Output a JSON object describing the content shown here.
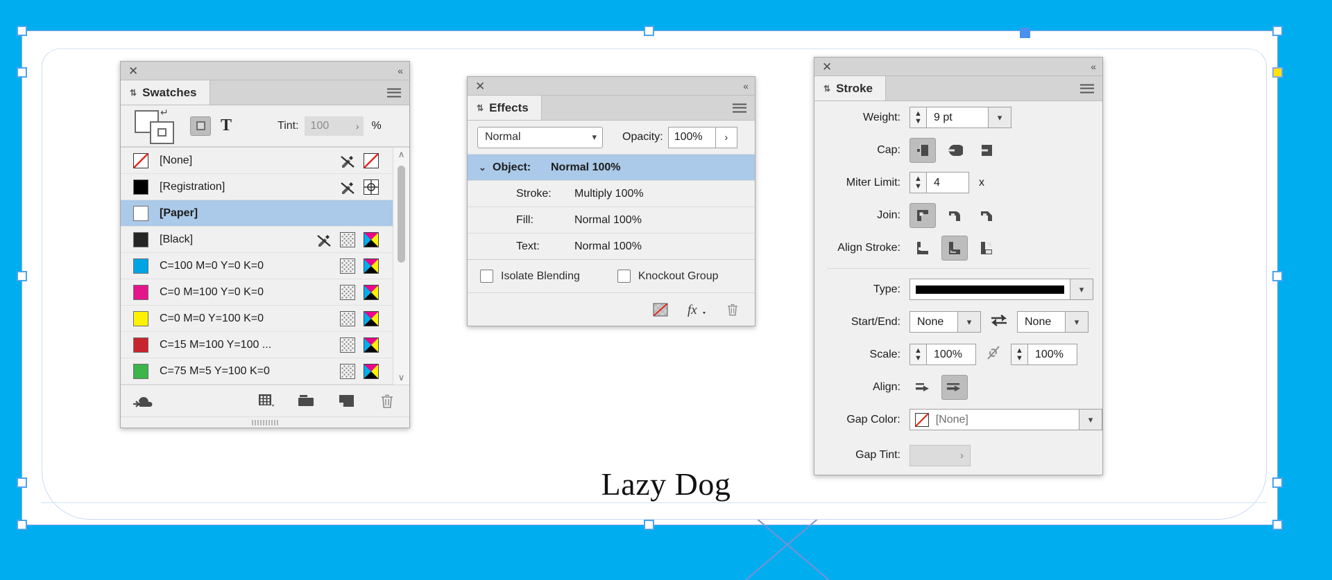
{
  "app": {
    "canvas_text": "Lazy Dog",
    "canvas_bg": "#00aeef",
    "page_bg": "#ffffff",
    "selection_color": "#4da3f0",
    "handle_yellow": "#ffe400",
    "handle_blue": "#4a90f0"
  },
  "swatches": {
    "close_label": "✕",
    "collapse_label": "«",
    "tab_label": "Swatches",
    "tab_grip": "⇅",
    "menu_name": "panel-menu-icon",
    "format_fill_icon": "fill-format-icon",
    "format_text_label": "T",
    "tint_label": "Tint:",
    "tint_value": "100",
    "tint_chevron": "›",
    "tint_unit": "%",
    "rows": [
      {
        "name": "[None]",
        "chip": "none",
        "swatch_icon": true,
        "tint_icon": false,
        "cmyk_icon": false,
        "selected": false
      },
      {
        "name": "[Registration]",
        "chip": "#000000",
        "swatch_icon": true,
        "tint_icon": false,
        "cmyk_icon": false,
        "reg_icon": true,
        "selected": false
      },
      {
        "name": "[Paper]",
        "chip": "#ffffff",
        "swatch_icon": false,
        "tint_icon": false,
        "cmyk_icon": false,
        "selected": true
      },
      {
        "name": "[Black]",
        "chip": "#262626",
        "swatch_icon": true,
        "tint_icon": true,
        "cmyk_icon": true,
        "selected": false
      },
      {
        "name": "C=100 M=0 Y=0 K=0",
        "chip": "#00a5e3",
        "swatch_icon": false,
        "tint_icon": true,
        "cmyk_icon": true,
        "selected": false
      },
      {
        "name": "C=0 M=100 Y=0 K=0",
        "chip": "#e5158c",
        "swatch_icon": false,
        "tint_icon": true,
        "cmyk_icon": true,
        "selected": false
      },
      {
        "name": "C=0 M=0 Y=100 K=0",
        "chip": "#fff200",
        "swatch_icon": false,
        "tint_icon": true,
        "cmyk_icon": true,
        "selected": false
      },
      {
        "name": "C=15 M=100 Y=100 ...",
        "chip": "#c9252d",
        "swatch_icon": false,
        "tint_icon": true,
        "cmyk_icon": true,
        "selected": false
      },
      {
        "name": "C=75 M=5 Y=100 K=0",
        "chip": "#3cb54a",
        "swatch_icon": false,
        "tint_icon": true,
        "cmyk_icon": true,
        "selected": false
      }
    ],
    "scroll_up": "∧",
    "scroll_down": "∨",
    "footer_icons": [
      "cc-libraries-icon",
      "new-color-group-icon",
      "new-swatch-group-icon",
      "new-swatch-icon",
      "delete-swatch-icon"
    ]
  },
  "effects": {
    "close_label": "✕",
    "collapse_label": "«",
    "tab_label": "Effects",
    "tab_grip": "⇅",
    "blend_mode": "Normal",
    "opacity_label": "Opacity:",
    "opacity_value": "100%",
    "opacity_arrow": "›",
    "rows": [
      {
        "key": "Object:",
        "value": "Normal 100%",
        "selected": true,
        "disclosure": "⌄"
      },
      {
        "key": "Stroke:",
        "value": "Multiply 100%",
        "selected": false,
        "disclosure": ""
      },
      {
        "key": "Fill:",
        "value": "Normal 100%",
        "selected": false,
        "disclosure": ""
      },
      {
        "key": "Text:",
        "value": "Normal 100%",
        "selected": false,
        "disclosure": ""
      }
    ],
    "isolate_blending": "Isolate Blending",
    "knockout_group": "Knockout Group",
    "footer_icons": [
      "clear-effects-icon",
      "fx-icon",
      "delete-effect-icon"
    ]
  },
  "stroke": {
    "close_label": "✕",
    "collapse_label": "«",
    "tab_label": "Stroke",
    "tab_grip": "⇅",
    "weight_label": "Weight:",
    "weight_value": "9 pt",
    "cap_label": "Cap:",
    "cap_options": [
      "butt-cap",
      "round-cap",
      "projecting-cap"
    ],
    "cap_selected": 0,
    "miter_label": "Miter Limit:",
    "miter_value": "4",
    "miter_unit": "x",
    "join_label": "Join:",
    "join_options": [
      "miter-join",
      "round-join",
      "bevel-join"
    ],
    "join_selected": 0,
    "align_stroke_label": "Align Stroke:",
    "align_stroke_options": [
      "align-stroke-center",
      "align-stroke-inside",
      "align-stroke-outside"
    ],
    "align_stroke_selected": 1,
    "type_label": "Type:",
    "type_value": "solid-line",
    "startend_label": "Start/End:",
    "start_value": "None",
    "end_value": "None",
    "swap_icon": "swap-arrows-icon",
    "scale_label": "Scale:",
    "scale_start": "100%",
    "scale_end": "100%",
    "link_icon": "link-broken-icon",
    "align_label": "Align:",
    "align_options": [
      "align-arrow-extend",
      "align-arrow-to-end"
    ],
    "align_selected": 1,
    "gap_color_label": "Gap Color:",
    "gap_color_value": "[None]",
    "gap_tint_label": "Gap Tint:",
    "gap_tint_value": "",
    "gap_tint_chevron": "›"
  }
}
